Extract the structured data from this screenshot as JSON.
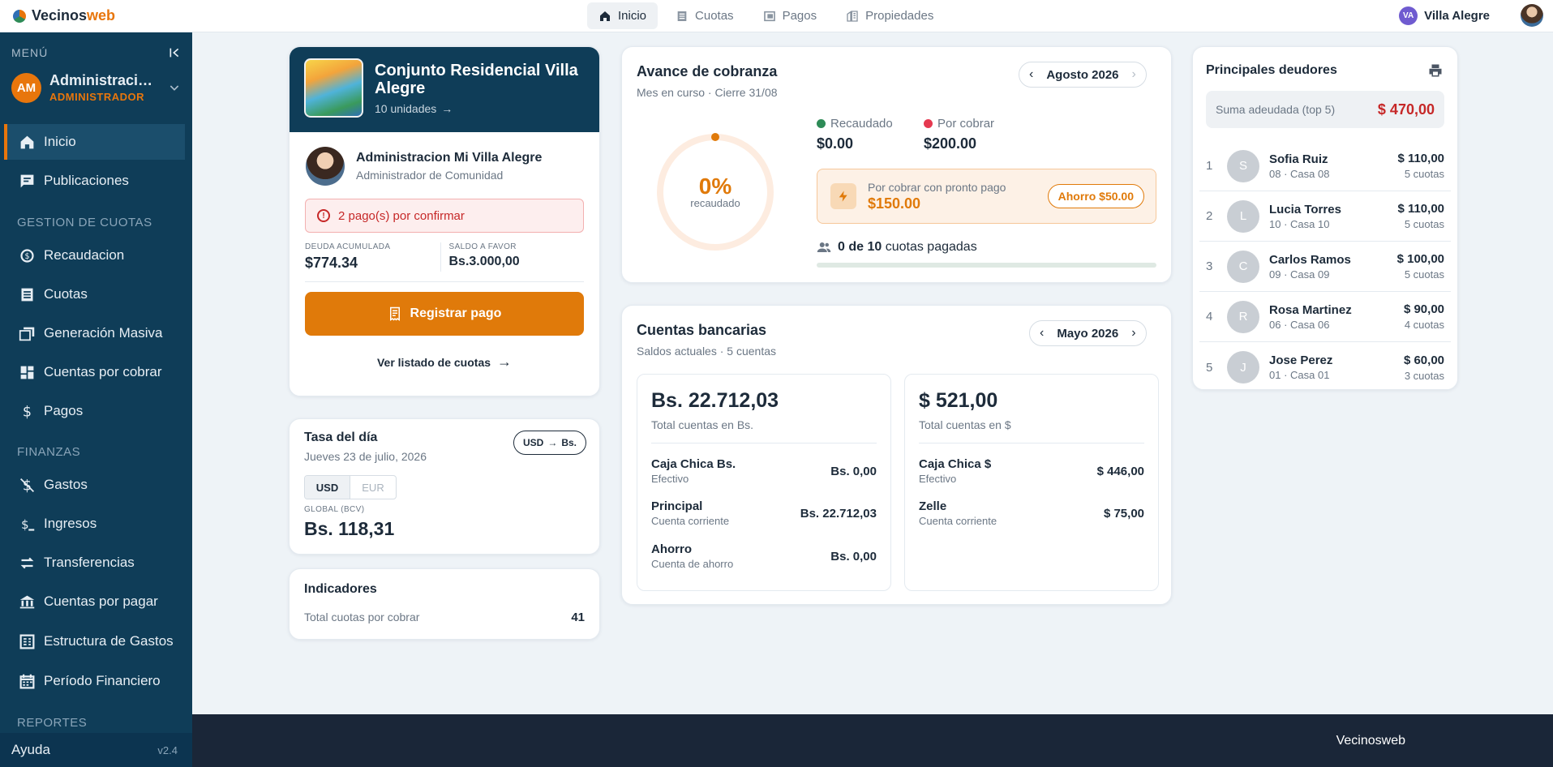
{
  "brand": {
    "part1": "Vecinos",
    "part2": "web"
  },
  "topnav": [
    {
      "label": "Inicio",
      "active": true
    },
    {
      "label": "Cuotas",
      "active": false
    },
    {
      "label": "Pagos",
      "active": false
    },
    {
      "label": "Propiedades",
      "active": false
    }
  ],
  "user": {
    "initials": "VA",
    "name": "Villa Alegre"
  },
  "sidebar": {
    "menu_label": "MENÚ",
    "account": {
      "initials": "AM",
      "name": "Administracion Mi Villa Alegre",
      "role": "ADMINISTRADOR"
    },
    "items": [
      {
        "label": "Inicio",
        "icon": "home-icon"
      },
      {
        "label": "Publicaciones",
        "icon": "chat-icon"
      },
      {
        "label": "Recaudacion",
        "icon": "money-refresh-icon"
      },
      {
        "label": "Cuotas",
        "icon": "document-icon"
      },
      {
        "label": "Generación Masiva",
        "icon": "stack-icon"
      },
      {
        "label": "Cuentas por cobrar",
        "icon": "grid-icon"
      },
      {
        "label": "Pagos",
        "icon": "dollar-icon"
      },
      {
        "label": "Gastos",
        "icon": "money-off-icon"
      },
      {
        "label": "Ingresos",
        "icon": "money-in-icon"
      },
      {
        "label": "Transferencias",
        "icon": "swap-icon"
      },
      {
        "label": "Cuentas por pagar",
        "icon": "bank-icon"
      },
      {
        "label": "Estructura de Gastos",
        "icon": "table-icon"
      },
      {
        "label": "Período Financiero",
        "icon": "calendar-icon"
      }
    ],
    "sections": {
      "cuotas": "GESTION DE CUOTAS",
      "finanzas": "FINANZAS",
      "reportes": "REPORTES"
    },
    "help": "Ayuda",
    "version": "v2.4"
  },
  "community": {
    "name": "Conjunto Residencial Villa Alegre",
    "units": "10 unidades",
    "admin_name": "Administracion Mi Villa Alegre",
    "admin_role": "Administrador de Comunidad",
    "alert": "2 pago(s) por confirmar",
    "deuda_label": "DEUDA ACUMULADA",
    "deuda_value": "$774.34",
    "saldo_label": "SALDO A FAVOR",
    "saldo_value": "Bs.3.000,00",
    "register_button": "Registrar pago",
    "list_link": "Ver listado de cuotas"
  },
  "tasa": {
    "title": "Tasa del día",
    "date": "Jueves 23 de julio, 2026",
    "convert_from": "USD",
    "convert_to": "Bs.",
    "currencies": [
      "USD",
      "EUR"
    ],
    "global_label": "GLOBAL (BCV)",
    "global_value": "Bs. 118,31"
  },
  "indicadores": {
    "title": "Indicadores",
    "label": "Total cuotas por cobrar",
    "value": "41"
  },
  "avance": {
    "title": "Avance de cobranza",
    "subtitle": "Mes en curso · Cierre 31/08",
    "month": "Agosto 2026",
    "percent": "0%",
    "percent_label": "recaudado",
    "progress_fraction": 0,
    "recaudado_label": "Recaudado",
    "recaudado_value": "$0.00",
    "porcobrar_label": "Por cobrar",
    "porcobrar_value": "$200.00",
    "promo_label": "Por cobrar con pronto pago",
    "promo_value": "$150.00",
    "promo_badge": "Ahorro $50.00",
    "paid_count": "0 de 10",
    "paid_suffix": "cuotas pagadas",
    "colors": {
      "accent": "#e07a0a",
      "green": "#2e8b57",
      "red": "#e53950"
    }
  },
  "cuentas": {
    "title": "Cuentas bancarias",
    "subtitle": "Saldos actuales · 5 cuentas",
    "month": "Mayo 2026",
    "bs": {
      "total": "Bs. 22.712,03",
      "total_label": "Total cuentas en Bs.",
      "rows": [
        {
          "name": "Caja Chica Bs.",
          "type": "Efectivo",
          "amount": "Bs. 0,00"
        },
        {
          "name": "Principal",
          "type": "Cuenta corriente",
          "amount": "Bs. 22.712,03"
        },
        {
          "name": "Ahorro",
          "type": "Cuenta de ahorro",
          "amount": "Bs. 0,00"
        }
      ]
    },
    "usd": {
      "total": "$ 521,00",
      "total_label": "Total cuentas en $",
      "rows": [
        {
          "name": "Caja Chica $",
          "type": "Efectivo",
          "amount": "$ 446,00"
        },
        {
          "name": "Zelle",
          "type": "Cuenta corriente",
          "amount": "$ 75,00"
        }
      ]
    }
  },
  "deudores": {
    "title": "Principales deudores",
    "sum_label": "Suma adeudada (top 5)",
    "sum_value": "$ 470,00",
    "rows": [
      {
        "idx": "1",
        "initial": "S",
        "name": "Sofia Ruiz",
        "unit": "08 · Casa 08",
        "amount": "$ 110,00",
        "cuotas": "5 cuotas"
      },
      {
        "idx": "2",
        "initial": "L",
        "name": "Lucia Torres",
        "unit": "10 · Casa 10",
        "amount": "$ 110,00",
        "cuotas": "5 cuotas"
      },
      {
        "idx": "3",
        "initial": "C",
        "name": "Carlos Ramos",
        "unit": "09 · Casa 09",
        "amount": "$ 100,00",
        "cuotas": "5 cuotas"
      },
      {
        "idx": "4",
        "initial": "R",
        "name": "Rosa Martinez",
        "unit": "06 · Casa 06",
        "amount": "$ 90,00",
        "cuotas": "4 cuotas"
      },
      {
        "idx": "5",
        "initial": "J",
        "name": "Jose Perez",
        "unit": "01 · Casa 01",
        "amount": "$ 60,00",
        "cuotas": "3 cuotas"
      }
    ]
  },
  "footer": {
    "text": "Vecinosweb"
  }
}
